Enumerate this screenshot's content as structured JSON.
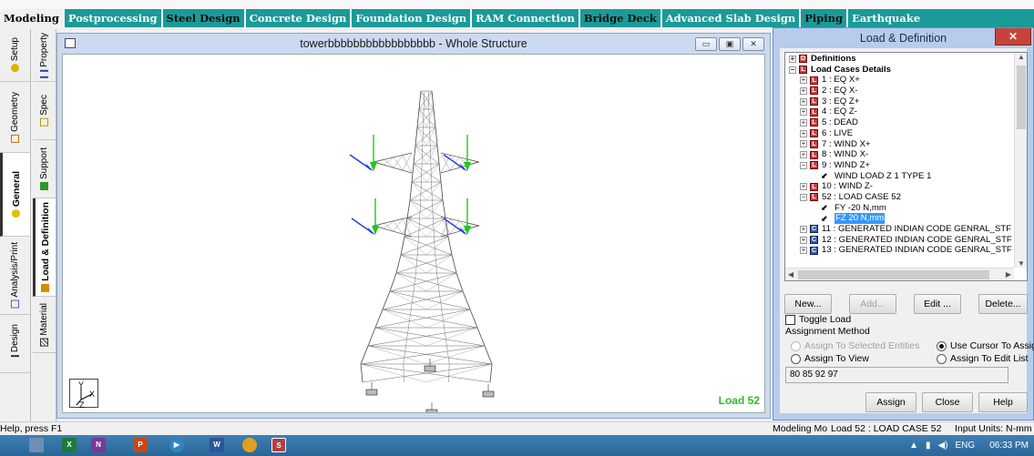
{
  "tabs": [
    "Modeling",
    "Postprocessing",
    "Steel Design",
    "Concrete Design",
    "Foundation Design",
    "RAM Connection",
    "Bridge Deck",
    "Advanced Slab Design",
    "Piping",
    "Earthquake"
  ],
  "left_pages": {
    "outer": [
      "Setup",
      "Geometry",
      "General",
      "Analysis/Print",
      "Design"
    ],
    "inner": [
      "Property",
      "Spec",
      "Support",
      "Load & Definition",
      "Material"
    ]
  },
  "viewport": {
    "title": "towerbbbbbbbbbbbbbbbbb - Whole Structure",
    "load_label": "Load 52",
    "axis_labels": [
      "Y",
      "X",
      "Z"
    ]
  },
  "dialog": {
    "title": "Load & Definition",
    "close": "✕",
    "tree": [
      {
        "pm": "+",
        "badge": "D",
        "text": "Definitions",
        "bold": true,
        "indent": 0
      },
      {
        "pm": "−",
        "badge": "L",
        "text": "Load Cases Details",
        "bold": true,
        "indent": 0
      },
      {
        "pm": "+",
        "badge": "L",
        "text": "1 : EQ X+",
        "indent": 1
      },
      {
        "pm": "+",
        "badge": "L",
        "text": "2 : EQ X-",
        "indent": 1
      },
      {
        "pm": "+",
        "badge": "L",
        "text": "3 : EQ Z+",
        "indent": 1
      },
      {
        "pm": "+",
        "badge": "L",
        "text": "4 : EQ Z-",
        "indent": 1
      },
      {
        "pm": "+",
        "badge": "L",
        "text": "5 : DEAD",
        "indent": 1
      },
      {
        "pm": "+",
        "badge": "L",
        "text": "6 : LIVE",
        "indent": 1
      },
      {
        "pm": "+",
        "badge": "L",
        "text": "7 : WIND X+",
        "indent": 1
      },
      {
        "pm": "+",
        "badge": "L",
        "text": "8 : WIND X-",
        "indent": 1
      },
      {
        "pm": "−",
        "badge": "L",
        "text": "9 : WIND Z+",
        "indent": 1
      },
      {
        "pm": "",
        "badge": "load",
        "text": "WIND LOAD Z 1 TYPE 1",
        "indent": 2
      },
      {
        "pm": "+",
        "badge": "L",
        "text": "10 : WIND Z-",
        "indent": 1
      },
      {
        "pm": "−",
        "badge": "L",
        "text": "52 : LOAD CASE 52",
        "indent": 1
      },
      {
        "pm": "",
        "badge": "load",
        "text": "FY -20 N,mm",
        "indent": 2
      },
      {
        "pm": "",
        "badge": "load",
        "text": "FZ 20 N,mm",
        "indent": 2,
        "selected": true
      },
      {
        "pm": "+",
        "badge": "C",
        "text": "11 : GENERATED INDIAN CODE GENRAL_STF",
        "indent": 1
      },
      {
        "pm": "+",
        "badge": "C",
        "text": "12 : GENERATED INDIAN CODE GENRAL_STF",
        "indent": 1
      },
      {
        "pm": "+",
        "badge": "C",
        "text": "13 : GENERATED INDIAN CODE GENRAL_STF",
        "indent": 1
      }
    ],
    "buttons": {
      "new": "New...",
      "add": "Add...",
      "edit": "Edit ...",
      "delete": "Delete..."
    },
    "toggle_load": "Toggle Load",
    "assignment_method": "Assignment Method",
    "radios": {
      "selected_entities": "Assign To Selected Entities",
      "use_cursor": "Use Cursor To Assign",
      "assign_view": "Assign To View",
      "edit_list": "Assign To Edit List"
    },
    "list_value": "80 85 92 97",
    "bottom": {
      "assign": "Assign",
      "close": "Close",
      "help": "Help"
    }
  },
  "status": {
    "left": "Help, press F1",
    "mode": "Modeling Mo",
    "load": "Load 52 : LOAD CASE 52",
    "units": "Input Units:  N-mm"
  },
  "taskbar": {
    "lang": "ENG",
    "time": "06:33 PM"
  }
}
